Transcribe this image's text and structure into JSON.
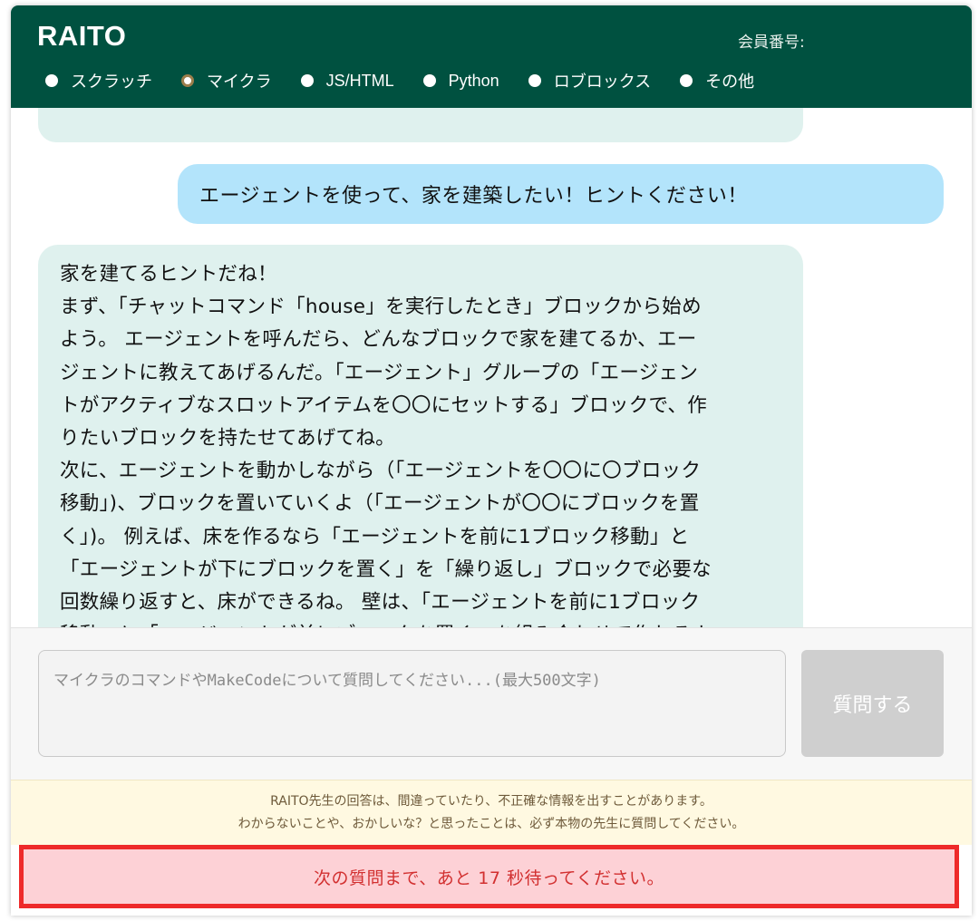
{
  "header": {
    "brand": "RAITO",
    "member_label": "会員番号:",
    "categories": [
      {
        "label": "スクラッチ",
        "selected": false
      },
      {
        "label": "マイクラ",
        "selected": true
      },
      {
        "label": "JS/HTML",
        "selected": false
      },
      {
        "label": "Python",
        "selected": false
      },
      {
        "label": "ロブロックス",
        "selected": false
      },
      {
        "label": "その他",
        "selected": false
      }
    ]
  },
  "chat": {
    "user_message": "エージェントを使って、家を建築したい！ヒントください！",
    "ai_message_lines": [
      "家を建てるヒントだね！",
      "まず、「チャットコマンド「house」を実行したとき」ブロックから始め",
      "よう。 エージェントを呼んだら、どんなブロックで家を建てるか、エー",
      "ジェントに教えてあげるんだ。「エージェント」グループの「エージェン",
      "トがアクティブなスロットアイテムを〇〇にセットする」ブロックで、作",
      "りたいブロックを持たせてあげてね。",
      "次に、エージェントを動かしながら（「エージェントを〇〇に〇ブロック",
      "移動」)、ブロックを置いていくよ（「エージェントが〇〇にブロックを置",
      "く」)。 例えば、床を作るなら「エージェントを前に1ブロック移動」と",
      "「エージェントが下にブロックを置く」を「繰り返し」ブロックで必要な",
      "回数繰り返すと、床ができるね。 壁は、「エージェントを前に1ブロック",
      "移動」と「エージェントが前にブロックを置く」を組み合わせて作れるよ。"
    ]
  },
  "input": {
    "placeholder": "マイクラのコマンドやMakeCodeについて質問してください...(最大500文字)",
    "value": "",
    "submit_label": "質問する"
  },
  "notice": {
    "line1": "RAITO先生の回答は、間違っていたり、不正確な情報を出すことがあります。",
    "line2": "わからないことや、おかしいな？と思ったことは、必ず本物の先生に質問してください。"
  },
  "wait_message": "次の質問まで、あと 17 秒待ってください。",
  "colors": {
    "header_bg": "#005140",
    "ai_bubble": "#dff1ee",
    "user_bubble": "#b3e4fb",
    "button_disabled": "#cfcfcf",
    "notice_bg": "#fff9e1",
    "wait_bg": "#fdd1d6",
    "wait_border": "#ee2a2a"
  }
}
